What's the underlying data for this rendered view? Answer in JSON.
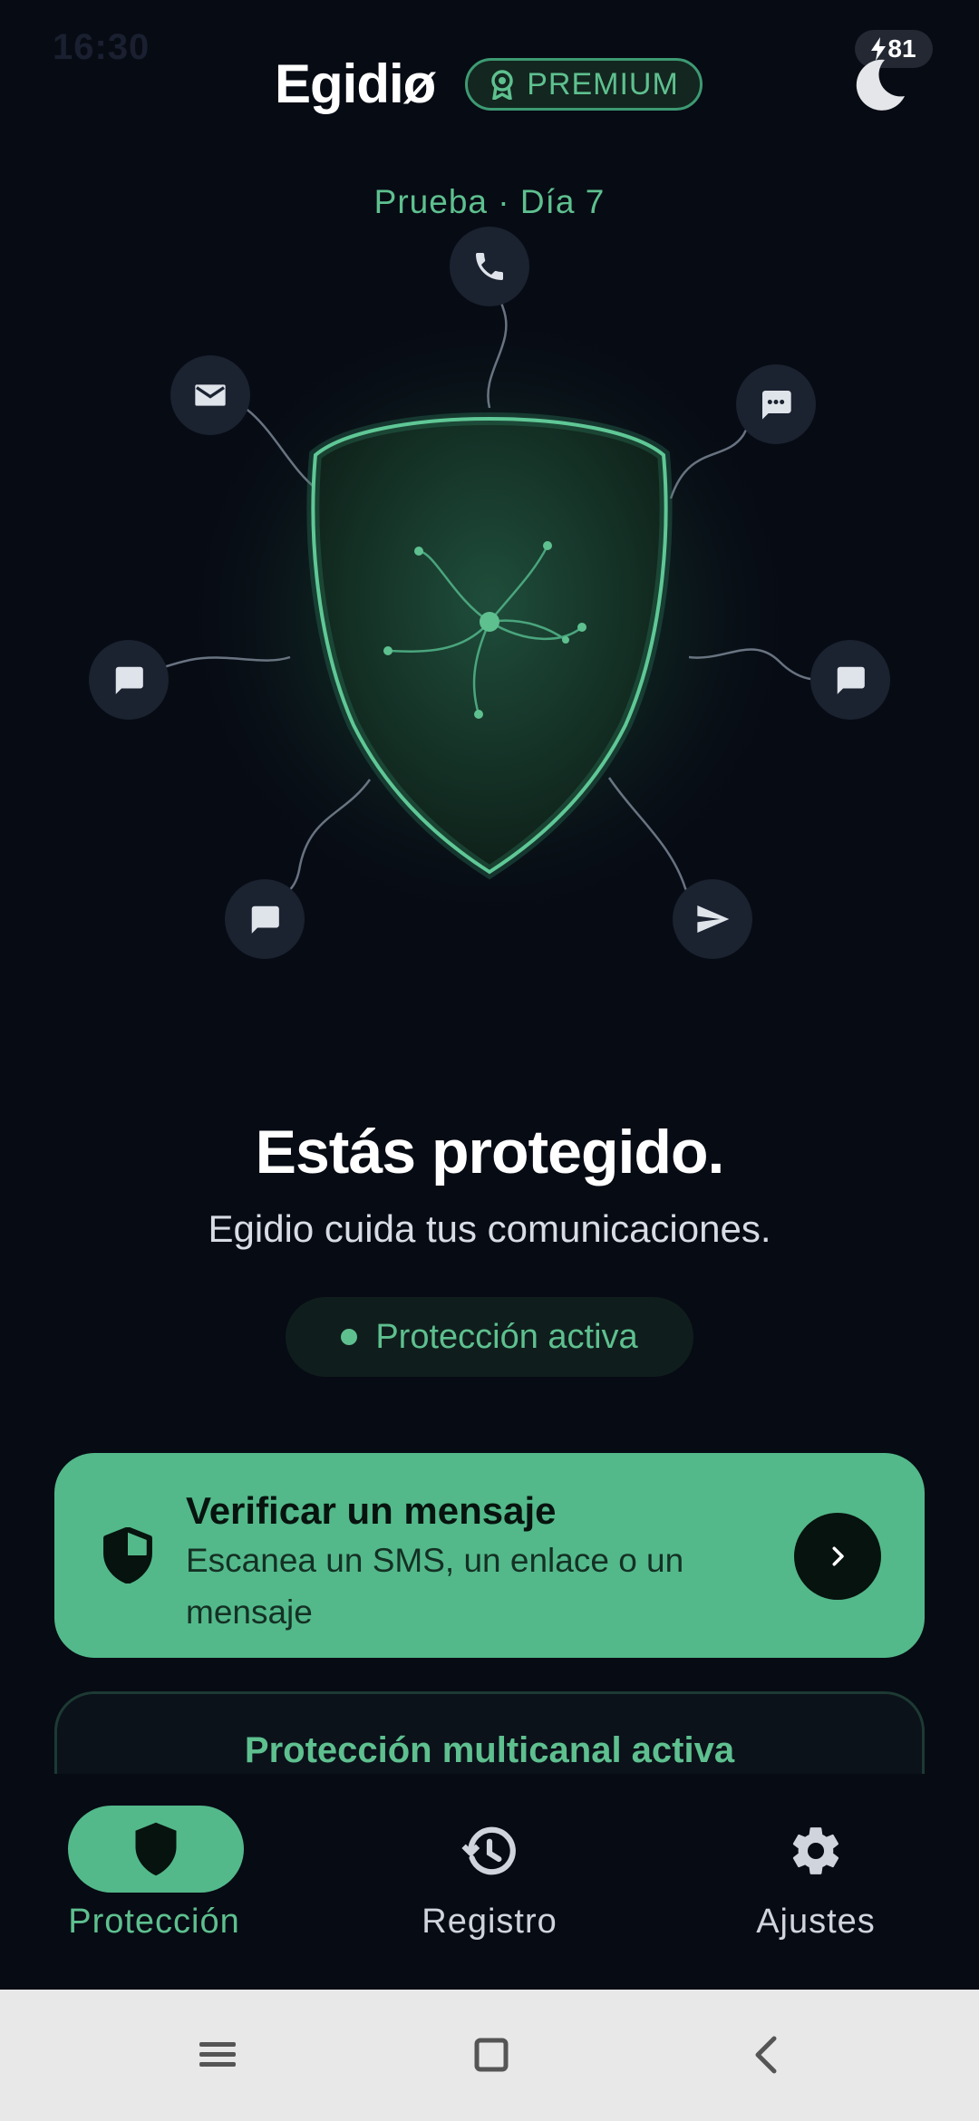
{
  "status_bar": {
    "time": "16:30",
    "battery": "81"
  },
  "header": {
    "app_name": "Egidiø",
    "badge_label": "PREMIUM",
    "theme_toggle_icon": "moon-icon",
    "trial_text": "Prueba · Día 7"
  },
  "hero": {
    "channel_icons": [
      "phone-icon",
      "message-icon",
      "email-icon",
      "chat-icon",
      "sms-icon",
      "chat-icon",
      "sms-icon",
      "send-icon"
    ]
  },
  "status": {
    "headline": "Estás protegido.",
    "subline": "Egidio cuida tus comunicaciones.",
    "pill_label": "Protección activa"
  },
  "verify_card": {
    "title": "Verificar un mensaje",
    "description": "Escanea un SMS, un enlace o un mensaje"
  },
  "multichannel_card": {
    "title": "Protección multicanal activa"
  },
  "bottom_nav": {
    "items": [
      {
        "label": "Protección",
        "icon": "shield-icon",
        "active": true
      },
      {
        "label": "Registro",
        "icon": "history-icon",
        "active": false
      },
      {
        "label": "Ajustes",
        "icon": "gear-icon",
        "active": false
      }
    ]
  },
  "colors": {
    "background": "#070b14",
    "accent": "#53b98a",
    "accent_text": "#5ec08f"
  }
}
